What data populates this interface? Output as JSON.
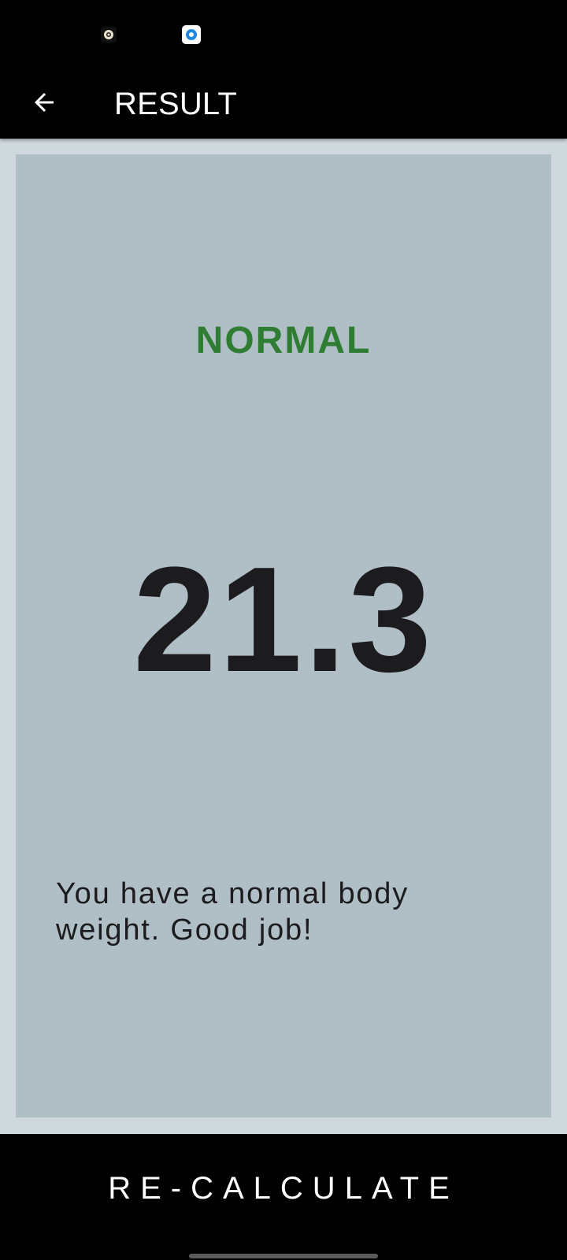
{
  "status_bar": {
    "icons": [
      "notification-app-icon",
      "notification-app-icon"
    ]
  },
  "app_bar": {
    "back_icon": "arrow-left-icon",
    "title": "RESULT"
  },
  "result": {
    "category": "NORMAL",
    "category_color": "#2e7d32",
    "bmi": "21.3",
    "message": "You have a normal body weight. Good job!"
  },
  "actions": {
    "recalculate_label": "RE-CALCULATE"
  },
  "colors": {
    "background": "#cfd8dc",
    "card": "#b0bec5",
    "bars": "#000000",
    "text_dark": "#1c1c1e"
  }
}
